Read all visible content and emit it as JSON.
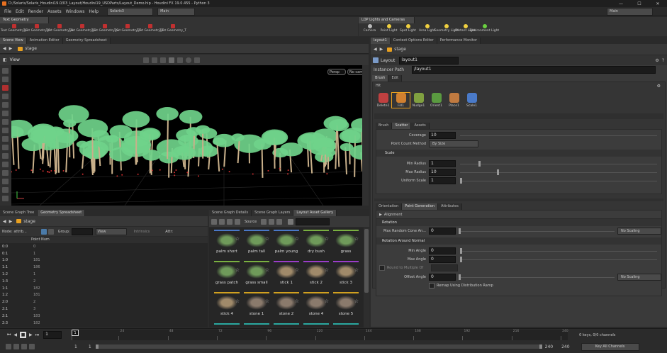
{
  "titlebar": {
    "title": "D:/Solaris/Solaris_Houdini19.0/03_Layout/Houdini19_USDParts/Layout_Demo.hip - Houdini FX 19.0.455 - Python 3"
  },
  "menubar": {
    "items": [
      "File",
      "Edit",
      "Render",
      "Assets",
      "Windows",
      "Help"
    ],
    "desktop": "Solaris3",
    "main_label": "Main",
    "right_main": "Main"
  },
  "shelf_left": {
    "tab": "Text Geometry",
    "items": [
      "Text Geometry_C",
      "Text Geometry_P",
      "Text Geometry_R",
      "Text Geometry_E",
      "Text Geometry_S",
      "Text Geometry_T",
      "Text Geometry_T",
      "Text Geometry_T"
    ]
  },
  "shelf_right": {
    "tab": "LOP Lights and Cameras",
    "items": [
      "Camera",
      "Point Light",
      "Spot Light",
      "Area Light",
      "Geometry Light",
      "Distant Light",
      "Environment Light"
    ]
  },
  "left_tabs": [
    "Scene View",
    "Animation Editor",
    "Geometry Spreadsheet"
  ],
  "path_stage": "stage",
  "viewport": {
    "label": "View",
    "persp": "Persp",
    "cam": "No cam"
  },
  "bottom_left_tabs": [
    "Scene Graph Tree",
    "Geometry Spreadsheet"
  ],
  "spreadsheet": {
    "path": "stage",
    "node_label": "Node: attrib...",
    "group_label": "Group:",
    "view_label": "View",
    "intrinsics": "Intrinsics",
    "attr_label": "Attr:",
    "column": "Point Num",
    "rows": [
      [
        "0:0",
        "0"
      ],
      [
        "0:1",
        "1"
      ],
      [
        "1:0",
        "181"
      ],
      [
        "1:1",
        "186"
      ],
      [
        "1:2",
        "1"
      ],
      [
        "1:3",
        "2"
      ],
      [
        "1:1",
        "182"
      ],
      [
        "1:2",
        "181"
      ],
      [
        "2:0",
        "2"
      ],
      [
        "2:1",
        "3"
      ],
      [
        "2:1",
        "183"
      ],
      [
        "2:3",
        "182"
      ]
    ]
  },
  "bottom_mid_tabs": [
    "Scene Graph Details",
    "Scene Graph Layers",
    "Layout Asset Gallery"
  ],
  "gallery": {
    "source_label": "Source",
    "assets": [
      {
        "name": "palm short",
        "color": "#4a78c8"
      },
      {
        "name": "palm tall",
        "color": "#4a78c8"
      },
      {
        "name": "palm young",
        "color": "#4a78c8"
      },
      {
        "name": "dry bush",
        "color": "#7ab040"
      },
      {
        "name": "grass",
        "color": "#7ab040"
      },
      {
        "name": "grass patch",
        "color": "#7ab040"
      },
      {
        "name": "grass small",
        "color": "#7ab040"
      },
      {
        "name": "stick 1",
        "color": "#9a3cc8"
      },
      {
        "name": "stick 2",
        "color": "#9a3cc8"
      },
      {
        "name": "stick 3",
        "color": "#9a3cc8"
      },
      {
        "name": "stick 4",
        "color": "#d0a020"
      },
      {
        "name": "stone 1",
        "color": "#d0a020"
      },
      {
        "name": "stone 2",
        "color": "#d0a020"
      },
      {
        "name": "stone 4",
        "color": "#d0a020"
      },
      {
        "name": "stone 5",
        "color": "#d0a020"
      },
      {
        "name": "",
        "color": "#2aa8a0"
      },
      {
        "name": "",
        "color": "#2aa8a0"
      },
      {
        "name": "",
        "color": "#2aa8a0"
      },
      {
        "name": "",
        "color": "#2aa8a0"
      },
      {
        "name": "",
        "color": "#2aa8a0"
      }
    ]
  },
  "right_tabs": [
    "layout1",
    "Context Options Editor",
    "Performance Monitor"
  ],
  "params": {
    "type": "Layout",
    "name": "layout1",
    "instancer_label": "Instancer Path",
    "instancer_value": "/layout1",
    "tabs": [
      "Brush",
      "Edit"
    ],
    "brush_section": "Hit",
    "tools": [
      "Delete1",
      "Fill1",
      "Nudge1",
      "Orient1",
      "Place1",
      "Scale1"
    ],
    "subtabs": [
      "Brush",
      "Scatter",
      "Assets"
    ],
    "coverage_label": "Coverage",
    "coverage_value": "10",
    "point_count_label": "Point Count Method",
    "point_count_value": "By Size",
    "scale_header": "Scale",
    "min_radius_label": "Min Radius",
    "min_radius_value": "1",
    "max_radius_label": "Max Radius",
    "max_radius_value": "10",
    "uniform_scale_label": "Uniform Scale",
    "uniform_scale_value": "1",
    "lower_tabs": [
      "Orientation",
      "Point Generation",
      "Attributes"
    ],
    "alignment_label": "Alignment",
    "rotation_header": "Rotation",
    "max_random_cone_label": "Max Random Cone An...",
    "max_random_cone_value": "0",
    "no_scaling_1": "No Scaling",
    "rotation_around_normal": "Rotation Around Normal",
    "min_angle_label": "Min Angle",
    "min_angle_value": "0",
    "max_angle_label": "Max Angle",
    "max_angle_value": "0",
    "round_label": "Round to Multiple Of",
    "offset_label": "Offset Angle",
    "offset_value": "0",
    "no_scaling_2": "No Scaling",
    "remap_label": "Remap Using Distribution Ramp"
  },
  "timeline": {
    "frame": "1",
    "ticks": [
      "1",
      "24",
      "48",
      "72",
      "96",
      "120",
      "144",
      "168",
      "192",
      "216",
      "240"
    ],
    "start": "1",
    "start2": "1",
    "end": "240",
    "end2": "240",
    "keys": "0 keys, 0/0 channels",
    "key_all": "Key All Channels"
  },
  "colors": {
    "accent": "#e8a020",
    "foliage": "#6fd38a",
    "trunk": "#c9b08a"
  }
}
